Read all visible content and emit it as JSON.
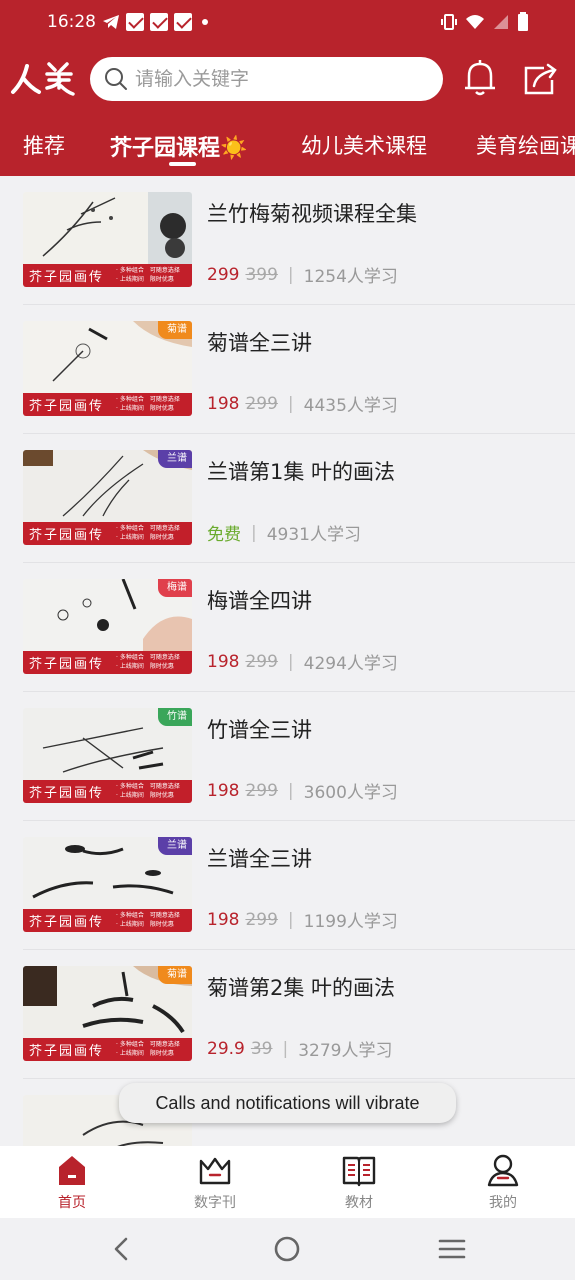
{
  "status_bar": {
    "time": "16:28"
  },
  "header": {
    "search": {
      "placeholder": "请输入关键字"
    },
    "tabs": [
      {
        "label": "推荐",
        "active": false
      },
      {
        "label": "芥子园课程☀️",
        "active": true
      },
      {
        "label": "幼儿美术课程",
        "active": false
      },
      {
        "label": "美育绘画课",
        "active": false
      }
    ]
  },
  "thumbnail": {
    "banner_title": "芥子园画传",
    "banner_note_1": "· 多种组合　可随意选择",
    "banner_note_2": "· 上线期间　限时优惠"
  },
  "courses": [
    {
      "title": "兰竹梅菊视频课程全集",
      "price": "299",
      "original_price": "399",
      "learners": "1254人学习",
      "badge": "",
      "badge_color": ""
    },
    {
      "title": "菊谱全三讲",
      "price": "198",
      "original_price": "299",
      "learners": "4435人学习",
      "badge": "菊谱",
      "badge_color": "#f08a1c"
    },
    {
      "title": "兰谱第1集 叶的画法",
      "price": "免费",
      "original_price": "",
      "learners": "4931人学习",
      "badge": "兰谱",
      "badge_color": "#5b3fa8"
    },
    {
      "title": "梅谱全四讲",
      "price": "198",
      "original_price": "299",
      "learners": "4294人学习",
      "badge": "梅谱",
      "badge_color": "#e0404c"
    },
    {
      "title": "竹谱全三讲",
      "price": "198",
      "original_price": "299",
      "learners": "3600人学习",
      "badge": "竹谱",
      "badge_color": "#3aa65a"
    },
    {
      "title": "兰谱全三讲",
      "price": "198",
      "original_price": "299",
      "learners": "1199人学习",
      "badge": "兰谱",
      "badge_color": "#5b3fa8"
    },
    {
      "title": "菊谱第2集 叶的画法",
      "price": "29.9",
      "original_price": "39",
      "learners": "3279人学习",
      "badge": "菊谱",
      "badge_color": "#f08a1c"
    }
  ],
  "toast": {
    "text": "Calls and notifications will vibrate"
  },
  "bottom_nav": [
    {
      "label": "首页",
      "icon": "home-icon",
      "active": true
    },
    {
      "label": "数字刊",
      "icon": "digital-magazine-icon",
      "active": false
    },
    {
      "label": "教材",
      "icon": "textbook-icon",
      "active": false
    },
    {
      "label": "我的",
      "icon": "profile-icon",
      "active": false
    }
  ],
  "colors": {
    "brand_red": "#b8232c",
    "free_green": "#6aab2e",
    "price_gray": "#a8a8a8"
  }
}
